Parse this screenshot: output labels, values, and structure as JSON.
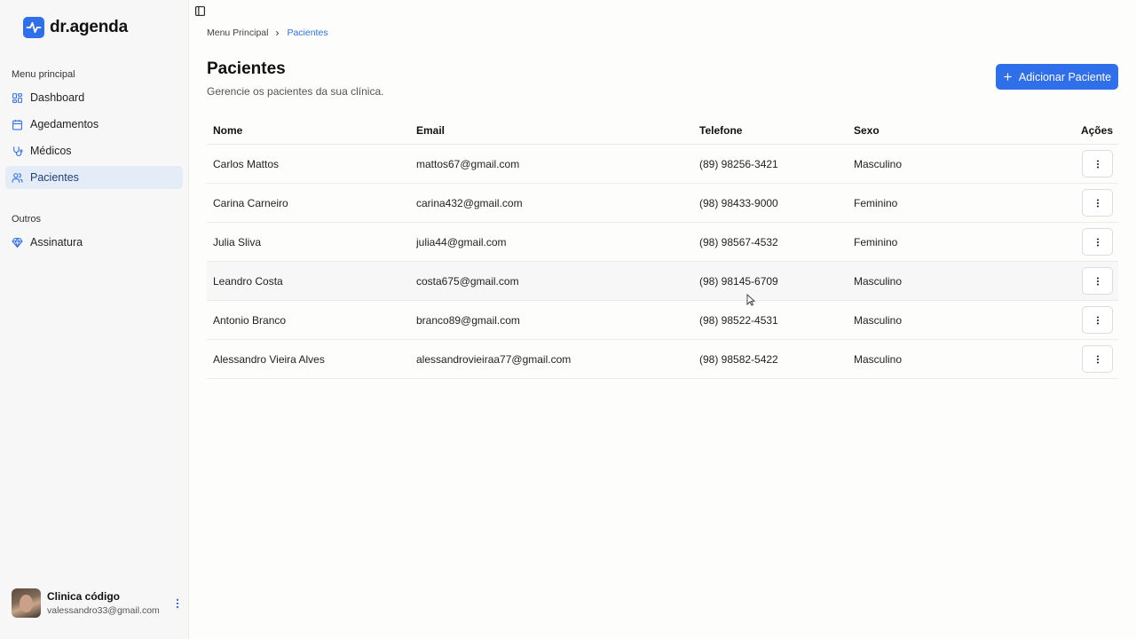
{
  "brand": {
    "name": "dr.agenda",
    "color": "#2f6fea"
  },
  "sidebar": {
    "main_label": "Menu principal",
    "items": [
      {
        "label": "Dashboard",
        "icon": "dashboard-icon"
      },
      {
        "label": "Agedamentos",
        "icon": "calendar-icon"
      },
      {
        "label": "Médicos",
        "icon": "stethoscope-icon"
      },
      {
        "label": "Pacientes",
        "icon": "users-icon",
        "active": true
      }
    ],
    "other_label": "Outros",
    "other_items": [
      {
        "label": "Assinatura",
        "icon": "gem-icon"
      }
    ]
  },
  "user": {
    "name": "Clinica código",
    "email": "valessandro33@gmail.com"
  },
  "breadcrumb": {
    "root": "Menu Principal",
    "current": "Pacientes"
  },
  "page": {
    "title": "Pacientes",
    "subtitle": "Gerencie os pacientes da sua clínica.",
    "add_label": "Adicionar Paciente"
  },
  "table": {
    "headers": {
      "nome": "Nome",
      "email": "Email",
      "telefone": "Telefone",
      "sexo": "Sexo",
      "acoes": "Ações"
    },
    "rows": [
      {
        "nome": "Carlos Mattos",
        "email": "mattos67@gmail.com",
        "telefone": "(89) 98256-3421",
        "sexo": "Masculino"
      },
      {
        "nome": "Carina Carneiro",
        "email": "carina432@gmail.com",
        "telefone": "(98) 98433-9000",
        "sexo": "Feminino"
      },
      {
        "nome": "Julia Sliva",
        "email": "julia44@gmail.com",
        "telefone": "(98) 98567-4532",
        "sexo": "Feminino"
      },
      {
        "nome": "Leandro Costa",
        "email": "costa675@gmail.com",
        "telefone": "(98) 98145-6709",
        "sexo": "Masculino"
      },
      {
        "nome": "Antonio Branco",
        "email": "branco89@gmail.com",
        "telefone": "(98) 98522-4531",
        "sexo": "Masculino"
      },
      {
        "nome": "Alessandro Vieira Alves",
        "email": "alessandrovieiraa77@gmail.com",
        "telefone": "(98) 98582-5422",
        "sexo": "Masculino"
      }
    ]
  }
}
